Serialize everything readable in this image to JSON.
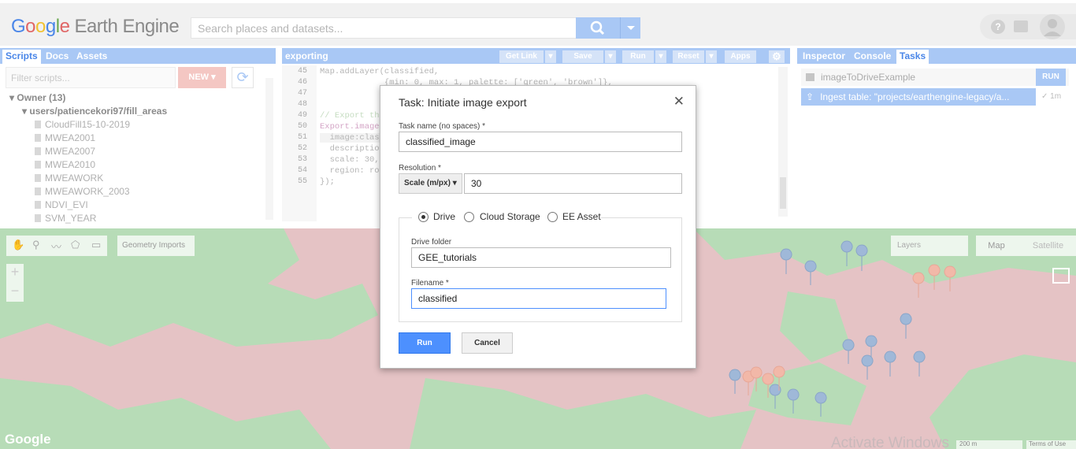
{
  "header": {
    "logo_google": "Google",
    "logo_product": "Earth Engine",
    "search_placeholder": "Search places and datasets..."
  },
  "left_panel": {
    "tabs": [
      "Scripts",
      "Docs",
      "Assets"
    ],
    "active_tab": "Scripts",
    "filter_placeholder": "Filter scripts...",
    "new_label": "NEW",
    "tree": {
      "owner": "Owner (13)",
      "folder": "users/patiencekori97/fill_areas",
      "files": [
        "CloudFill15-10-2019",
        "MWEA2001",
        "MWEA2007",
        "MWEA2010",
        "MWEAWORK",
        "MWEAWORK_2003",
        "NDVI_EVI",
        "SVM_YEAR"
      ]
    }
  },
  "editor": {
    "title": "exporting",
    "buttons": [
      "Get Link",
      "Save",
      "Run",
      "Reset",
      "Apps"
    ],
    "lines": [
      {
        "num": "45",
        "code": "Map.addLayer(classified,"
      },
      {
        "num": "46",
        "code": "             {min: 0, max: 1, palette: ['green', 'brown']},"
      },
      {
        "num": "47",
        "code": ""
      },
      {
        "num": "48",
        "code": ""
      },
      {
        "num": "49",
        "code": "// Export th"
      },
      {
        "num": "50",
        "code": "Export.image"
      },
      {
        "num": "51",
        "code": "  image:clas"
      },
      {
        "num": "52",
        "code": "  descriptio"
      },
      {
        "num": "53",
        "code": "  scale: 30,"
      },
      {
        "num": "54",
        "code": "  region: ro"
      },
      {
        "num": "55",
        "code": "});"
      }
    ]
  },
  "right_panel": {
    "tabs": [
      "Inspector",
      "Console",
      "Tasks"
    ],
    "active_tab": "Tasks",
    "tasks": [
      {
        "name": "imageToDriveExample",
        "action": "RUN"
      },
      {
        "name": "Ingest table: \"projects/earthengine-legacy/a...",
        "status": "✓ 1m"
      }
    ]
  },
  "map": {
    "geometry_imports": "Geometry Imports",
    "layers": "Layers",
    "map_type": "Map",
    "satellite": "Satellite",
    "zoom_in": "+",
    "zoom_out": "−",
    "google_logo": "Google",
    "watermark": "Activate Windows",
    "scale_label": "200 m",
    "terms": "Terms of Use",
    "colors": {
      "green": "#b7dcb7",
      "red": "#e5c3c5"
    }
  },
  "dialog": {
    "title": "Task: Initiate image export",
    "task_name_label": "Task name (no spaces) *",
    "task_name_value": "classified_image",
    "resolution_label": "Resolution *",
    "scale_option": "Scale (m/px)",
    "scale_value": "30",
    "destinations": [
      "Drive",
      "Cloud Storage",
      "EE Asset"
    ],
    "selected_destination": "Drive",
    "drive_folder_label": "Drive folder",
    "drive_folder_value": "GEE_tutorials",
    "filename_label": "Filename *",
    "filename_value": "classified",
    "run_label": "Run",
    "cancel_label": "Cancel"
  }
}
